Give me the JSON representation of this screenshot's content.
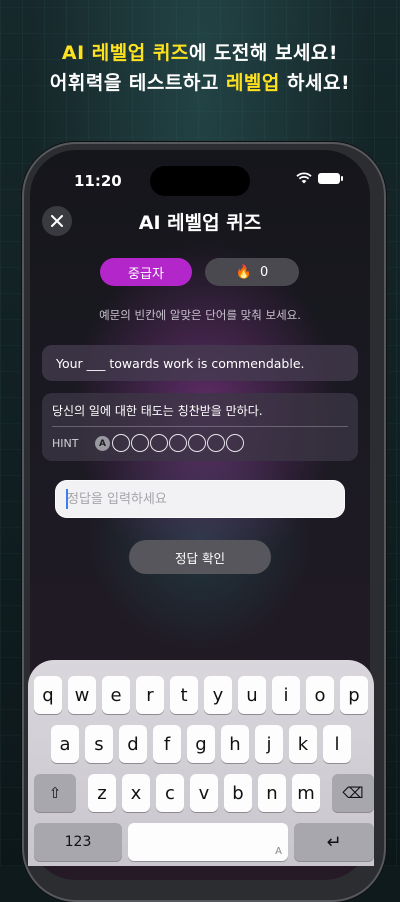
{
  "promo": {
    "line1_highlight": "AI 레벨업 퀴즈",
    "line1_rest": "에 도전해 보세요!",
    "line2_start": "어휘력을 테스트하고 ",
    "line2_highlight": "레벨업",
    "line2_end": " 하세요!"
  },
  "status_bar": {
    "time": "11:20"
  },
  "header": {
    "close_icon": "close-icon",
    "title": "AI 레벨업 퀴즈"
  },
  "level": {
    "label": "중급자"
  },
  "streak": {
    "icon": "fire-icon",
    "count": "0"
  },
  "instruction": "예문의 빈칸에 알맞은 단어를 맞춰 보세요.",
  "question": {
    "sentence": "Your ___ towards work is commendable.",
    "translation": "당신의 일에 대한 태도는 칭찬받을 만하다.",
    "hint_label": "HINT",
    "hint_first_letter": "A",
    "hint_blank_count": 7
  },
  "answer": {
    "placeholder": "정답을 입력하세요",
    "value": ""
  },
  "submit": {
    "label": "정답 확인"
  },
  "keyboard": {
    "row1": [
      "q",
      "w",
      "e",
      "r",
      "t",
      "y",
      "u",
      "i",
      "o",
      "p"
    ],
    "row2": [
      "a",
      "s",
      "d",
      "f",
      "g",
      "h",
      "j",
      "k",
      "l"
    ],
    "row3": [
      "z",
      "x",
      "c",
      "v",
      "b",
      "n",
      "m"
    ],
    "shift": "⇧",
    "delete": "⌫",
    "numbers": "123",
    "space_hint": "A",
    "return": "↵"
  },
  "colors": {
    "accent_purple": "#b326c9",
    "promo_yellow": "#ffe21f"
  }
}
